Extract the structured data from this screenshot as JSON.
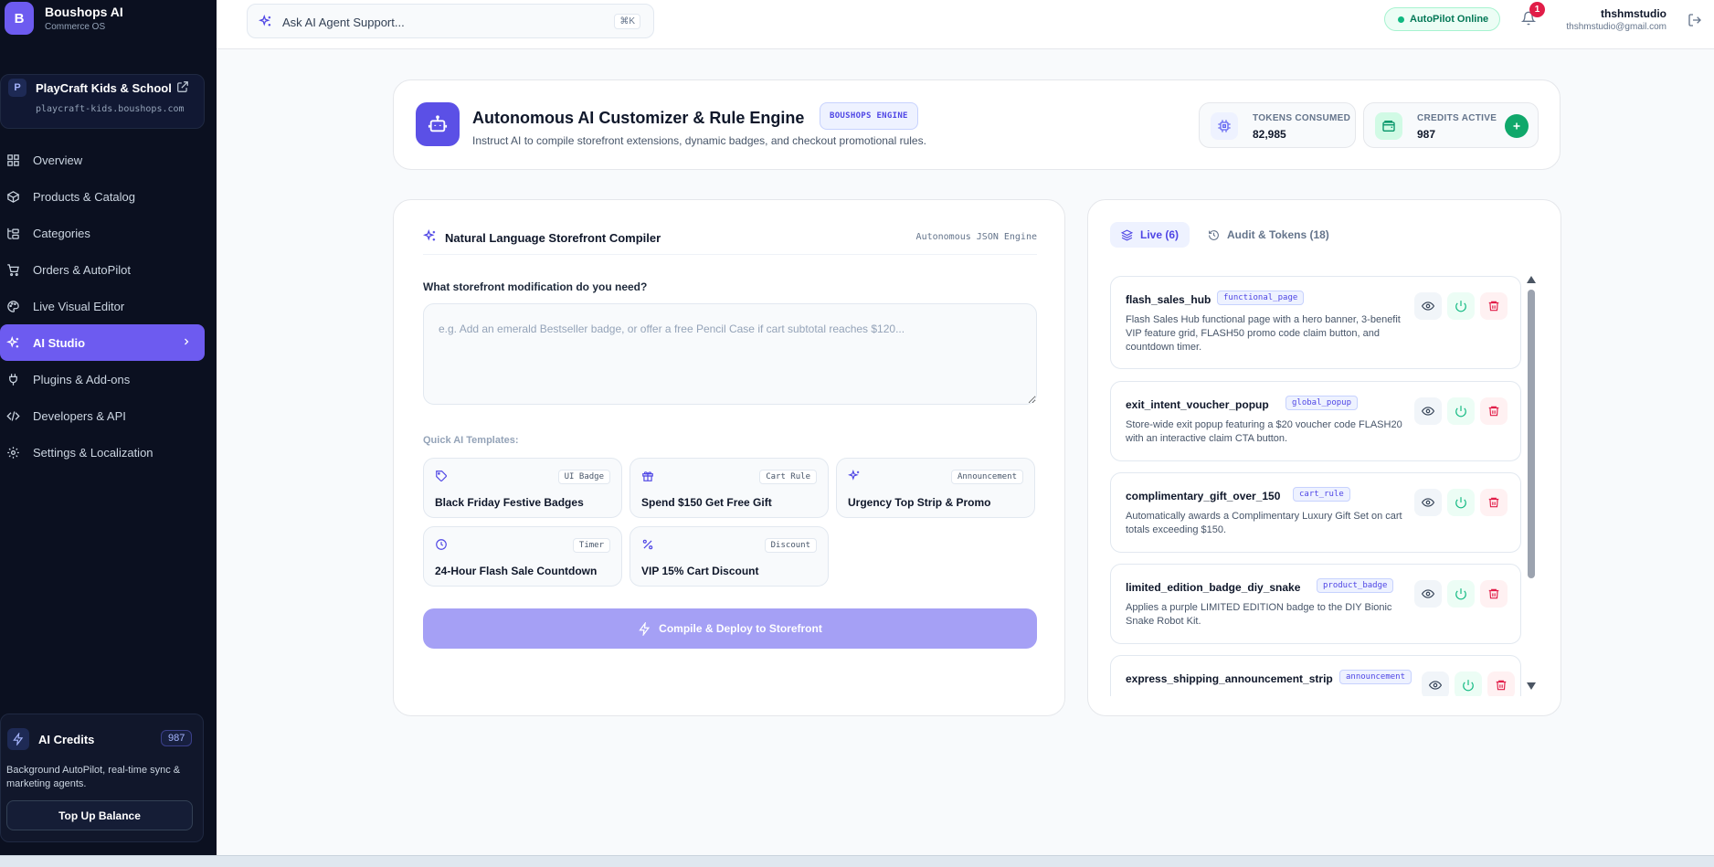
{
  "brand": {
    "logo": "B",
    "name": "Boushops AI",
    "subtitle": "Commerce OS"
  },
  "store": {
    "badge": "P",
    "name": "PlayCraft Kids & School",
    "url": "playcraft-kids.boushops.com"
  },
  "nav": [
    {
      "label": "Overview",
      "icon": "grid-icon"
    },
    {
      "label": "Products & Catalog",
      "icon": "box-icon"
    },
    {
      "label": "Categories",
      "icon": "folder-tree-icon"
    },
    {
      "label": "Orders & AutoPilot",
      "icon": "cart-icon"
    },
    {
      "label": "Live Visual Editor",
      "icon": "palette-icon"
    },
    {
      "label": "AI Studio",
      "icon": "sparkles-icon",
      "active": true
    },
    {
      "label": "Plugins & Add-ons",
      "icon": "plug-icon"
    },
    {
      "label": "Developers & API",
      "icon": "code-icon"
    },
    {
      "label": "Settings & Localization",
      "icon": "gear-icon"
    }
  ],
  "credits": {
    "title": "AI Credits",
    "count": "987",
    "description": "Background AutoPilot, real-time sync & marketing agents.",
    "topup_label": "Top Up Balance"
  },
  "topbar": {
    "search_placeholder": "Ask AI Agent Support...",
    "shortcut": "⌘K",
    "status": "AutoPilot Online",
    "notifications": "1",
    "user_name": "thshmstudio",
    "user_email": "thshmstudio@gmail.com"
  },
  "header": {
    "title": "Autonomous AI Customizer & Rule Engine",
    "pill": "BOUSHOPS ENGINE",
    "subtitle": "Instruct AI to compile storefront extensions, dynamic badges, and checkout promotional rules.",
    "tokens_label": "TOKENS CONSUMED",
    "tokens_value": "82,985",
    "credits_label": "CREDITS ACTIVE",
    "credits_value": "987"
  },
  "compiler": {
    "title": "Natural Language Storefront Compiler",
    "tag": "Autonomous JSON Engine",
    "question": "What storefront modification do you need?",
    "placeholder": "e.g. Add an emerald Bestseller badge, or offer a free Pencil Case if cart subtotal reaches $120...",
    "templates_label": "Quick AI Templates:",
    "templates": [
      {
        "tag": "UI Badge",
        "name": "Black Friday Festive Badges",
        "icon": "tag-icon"
      },
      {
        "tag": "Cart Rule",
        "name": "Spend $150 Get Free Gift",
        "icon": "gift-icon"
      },
      {
        "tag": "Announcement",
        "name": "Urgency Top Strip & Promo",
        "icon": "sparkles-icon"
      },
      {
        "tag": "Timer",
        "name": "24-Hour Flash Sale Countdown",
        "icon": "clock-icon"
      },
      {
        "tag": "Discount",
        "name": "VIP 15% Cart Discount",
        "icon": "percent-icon"
      }
    ],
    "deploy_label": "Compile & Deploy to Storefront"
  },
  "live": {
    "tab_live": "Live (6)",
    "tab_audit": "Audit & Tokens (18)",
    "rules": [
      {
        "name": "flash_sales_hub",
        "tag": "functional_page",
        "desc": "Flash Sales Hub functional page with a hero banner, 3-benefit VIP feature grid, FLASH50 promo code claim button, and countdown timer."
      },
      {
        "name": "exit_intent_voucher_popup",
        "tag": "global_popup",
        "desc": "Store-wide exit popup featuring a $20 voucher code FLASH20 with an interactive claim CTA button."
      },
      {
        "name": "complimentary_gift_over_150",
        "tag": "cart_rule",
        "desc": "Automatically awards a Complimentary Luxury Gift Set on cart totals exceeding $150."
      },
      {
        "name": "limited_edition_badge_diy_snake",
        "tag": "product_badge",
        "desc": "Applies a purple LIMITED EDITION badge to the DIY Bionic Snake Robot Kit."
      },
      {
        "name": "express_shipping_announcement_strip",
        "tag": "announcement",
        "desc": ""
      }
    ]
  },
  "colors": {
    "accent": "#6d5bf0",
    "sidebar_bg": "#0b1020",
    "success": "#10b981",
    "danger": "#e11d48"
  }
}
